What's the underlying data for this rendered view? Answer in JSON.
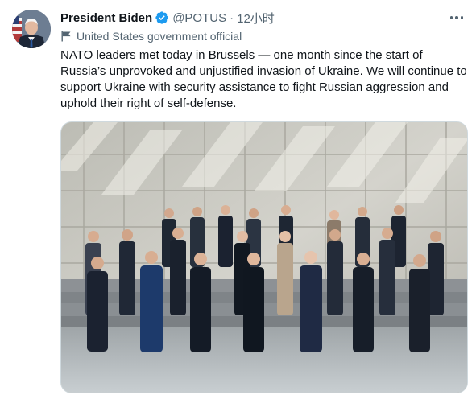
{
  "tweet": {
    "author_name": "President Biden",
    "handle": "@POTUS",
    "separator": "·",
    "time": "12小时",
    "account_label": "United States government official",
    "text": "NATO leaders met today in Brussels — one month since the start of Russia’s unprovoked and unjustified invasion of Ukraine. We will continue to support Ukraine with security assistance to fight Russian aggression and uphold their right of self-defense."
  },
  "icons": {
    "verified": "verified-badge-icon",
    "more": "more-dots-icon",
    "government_label": "flag-icon"
  },
  "colors": {
    "verified_blue": "#1d9bf0",
    "secondary_text": "#536471",
    "primary_text": "#0f1419"
  }
}
